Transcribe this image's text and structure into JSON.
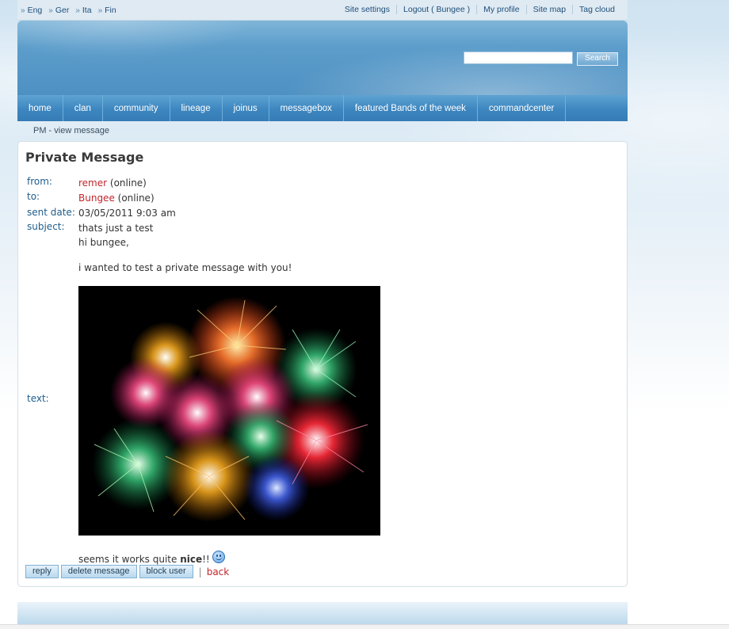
{
  "top": {
    "languages": [
      "Eng",
      "Ger",
      "Ita",
      "Fin"
    ],
    "links": [
      "Site settings",
      "Logout ( Bungee )",
      "My profile",
      "Site map",
      "Tag cloud"
    ]
  },
  "search": {
    "value": "",
    "button": "Search"
  },
  "nav": [
    "home",
    "clan",
    "community",
    "lineage",
    "joinus",
    "messagebox",
    "featured Bands of the week",
    "commandcenter"
  ],
  "breadcrumb": "PM - view message",
  "message": {
    "title": "Private Message",
    "labels": {
      "from": "from:",
      "to": "to:",
      "sent_date": "sent date:",
      "subject": "subject:",
      "text": "text:"
    },
    "from_user": "remer",
    "from_status": "(online)",
    "to_user": "Bungee",
    "to_status": "(online)",
    "sent_date": "03/05/2011 9:03 am",
    "subject": "thats just a test",
    "greeting": "hi bungee,",
    "body_line": "i wanted to test a private message with you!",
    "closing_pre": "seems it works quite ",
    "closing_bold": "nice",
    "closing_post": "!!"
  },
  "actions": {
    "reply": "reply",
    "delete": "delete message",
    "block": "block user",
    "separator": "|",
    "back": "back"
  },
  "colors": {
    "nav_bg": "#3d86bf",
    "label_blue": "#1f5d8c",
    "user_red": "#c0262d"
  },
  "icons": {
    "smiley": "smiley-icon",
    "lang_arrow": "double-chevron-right-icon"
  }
}
